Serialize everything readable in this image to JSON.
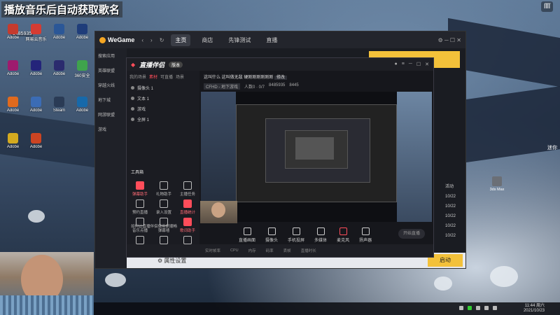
{
  "overlay": {
    "stream_title": "播放音乐后自动获取歌名",
    "room_number": "8485935",
    "corner_logo": "ſſſſ",
    "side_badge": "迷你",
    "side_icon_label": "3ds Max",
    "top_right_label": "ſſſſ"
  },
  "desktop_icons": [
    {
      "label": "Adobe",
      "color": "#c53b2e"
    },
    {
      "label": "网易云音乐",
      "color": "#d43c33"
    },
    {
      "label": "Adobe",
      "color": "#2b5797"
    },
    {
      "label": "Adobe",
      "color": "#1f3d7a"
    },
    {
      "label": "Adobe",
      "color": "#9e1b6e"
    },
    {
      "label": "Adobe",
      "color": "#24247a"
    },
    {
      "label": "Adobe",
      "color": "#2b2b6e"
    },
    {
      "label": "360安全",
      "color": "#3fa34d"
    },
    {
      "label": "Adobe",
      "color": "#e06a1e"
    },
    {
      "label": "Adobe",
      "color": "#3b6cb5"
    },
    {
      "label": "Steam",
      "color": "#2a3b55"
    },
    {
      "label": "Adobe",
      "color": "#1769aa"
    },
    {
      "label": "Adobe",
      "color": "#d4aa1f"
    },
    {
      "label": "Adobe",
      "color": "#c42"
    }
  ],
  "wegame": {
    "logo": "WeGame",
    "tabs": [
      "主页",
      "商店",
      "先锋测试",
      "直播"
    ],
    "sidebar": [
      "搜索应用",
      "英雄联盟",
      "穿越火线",
      "地下城",
      "网游联盟",
      "游戏"
    ],
    "list_items": [
      "10/22",
      "10/22",
      "10/22",
      "10/22",
      "10/22"
    ],
    "bottom_label": "属性设置",
    "launch_label": "启动",
    "list_header": "活动"
  },
  "zb": {
    "logo": "直播伴侣",
    "version_badge": "版本",
    "title_line": "这叫什么 这叫做无敌 硬刚刚刚刚刚刚",
    "title_tag": "修改",
    "sub_tags": [
      "CFHD - 地下游戏",
      "人数0 · 0/7",
      "8485935",
      "8445"
    ],
    "left_tabs": [
      "我的场景",
      "素材",
      "可直播",
      "场景"
    ],
    "scenes": [
      "摄像头 1",
      "文本 1",
      "游戏",
      "全屏 1"
    ],
    "tools_title": "工具箱",
    "tools": [
      {
        "label": "弹幕助手",
        "red": true
      },
      {
        "label": "礼物助手",
        "red": false
      },
      {
        "label": "主播任务",
        "red": false
      },
      {
        "label": "预约直播",
        "red": false
      },
      {
        "label": "录入设置",
        "red": false
      },
      {
        "label": "直播统计",
        "red": true
      },
      {
        "label": "音乐点播",
        "red": false
      },
      {
        "label": "弹幕墙",
        "red": false
      },
      {
        "label": "歌词助手",
        "red": true
      },
      {
        "label": "互动玩法",
        "red": false
      },
      {
        "label": "回放",
        "red": false
      },
      {
        "label": "直播间",
        "red": false
      }
    ],
    "controls": [
      "直播画面",
      "摄像头",
      "手机投屏",
      "多媒体",
      "麦克风",
      "扬声器"
    ],
    "start_label": "开始直播",
    "status": [
      "实时帧率",
      "CPU",
      "内存",
      "码率",
      "丢帧",
      "直播时长"
    ],
    "notice": "如何让直播伴侣使用更顺畅"
  },
  "taskbar": {
    "time": "11:44 周六",
    "date": "2021/10/23"
  }
}
